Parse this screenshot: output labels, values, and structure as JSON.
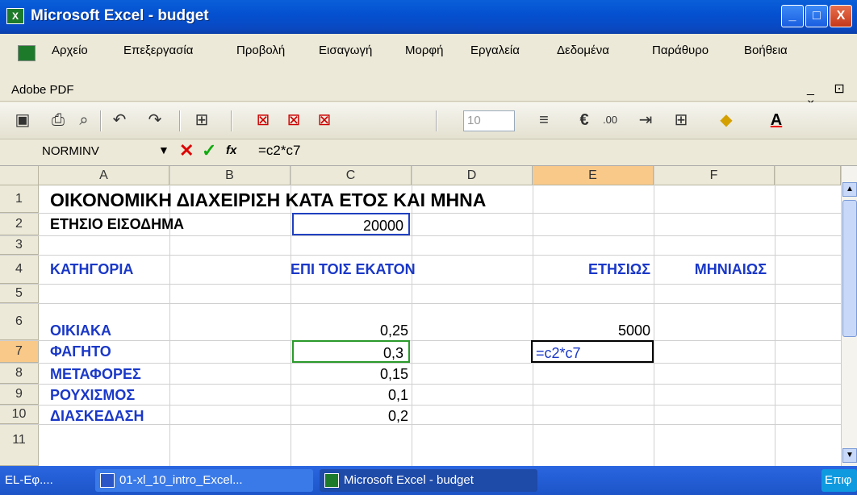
{
  "window": {
    "title": "Microsoft Excel - budget",
    "min": "_",
    "max": "□",
    "close": "X"
  },
  "menu": [
    "Αρχείο",
    "Επεξεργασία",
    "Προβολή",
    "Εισαγωγή",
    "Μορφή",
    "Εργαλεία",
    "Δεδομένα",
    "Παράθυρο",
    "Βοήθεια"
  ],
  "menu_row2": "Adobe PDF",
  "mdi_controls": "_ ⊡ ×",
  "toolbar": {
    "font_size": "10"
  },
  "formula_bar": {
    "name_box": "NORMINV",
    "fx": "fx",
    "formula": "=c2*c7"
  },
  "columns": [
    "A",
    "B",
    "C",
    "D",
    "E",
    "F"
  ],
  "rows": [
    "1",
    "2",
    "3",
    "4",
    "5",
    "6",
    "7",
    "8",
    "9",
    "10",
    "11"
  ],
  "cells": {
    "A1": "ΟΙΚΟΝΟΜΙΚΗ ΔΙΑΧΕΙΡΙΣΗ ΚΑΤΑ ΕΤΟΣ ΚΑΙ ΜΗΝΑ",
    "A2": "ΕΤΗΣΙΟ ΕΙΣΟΔΗΜΑ",
    "C2": "20000",
    "A4": "ΚΑΤΗΓΟΡΙΑ",
    "C4": "ΕΠΙ ΤΟΙΣ ΕΚΑΤΟΝ",
    "E4": "ΕΤΗΣΙΩΣ",
    "F4": "ΜΗΝΙΑΙΩΣ",
    "A6": "ΟΙΚΙΑΚΑ",
    "C6": "0,25",
    "E6": "5000",
    "A7": "ΦΑΓΗΤΟ",
    "C7": "0,3",
    "E7": "=c2*c7",
    "A8": "ΜΕΤΑΦΟΡΕΣ",
    "C8": "0,15",
    "A9": "ΡΟΥΧΙΣΜΟΣ",
    "C9": "0,1",
    "A10": "ΔΙΑΣΚΕΔΑΣΗ",
    "C10": "0,2"
  },
  "taskbar": {
    "left": "EL-Εφ....",
    "task1": "01-xl_10_intro_Excel...",
    "task2": "Microsoft Excel - budget",
    "right": "Επιφ"
  }
}
